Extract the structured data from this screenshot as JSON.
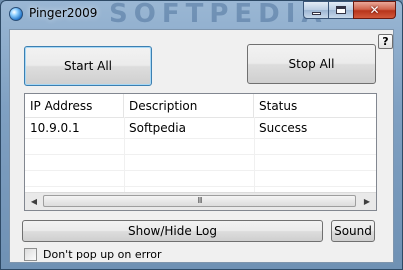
{
  "window": {
    "title": "Pinger2009",
    "watermark": "SOFTPEDIA"
  },
  "caption": {
    "minimize": "minimize",
    "maximize": "maximize",
    "close": "✕"
  },
  "help_label": "?",
  "buttons": {
    "start_all": "Start All",
    "stop_all": "Stop All",
    "show_hide_log": "Show/Hide Log",
    "sound": "Sound"
  },
  "table": {
    "columns": [
      "IP Address",
      "Description",
      "Status"
    ],
    "rows": [
      [
        "10.9.0.1",
        "Softpedia",
        "Success"
      ]
    ]
  },
  "scrollbar": {
    "left_arrow": "◀",
    "right_arrow": "▶",
    "grip": "III"
  },
  "options": {
    "dont_popup_label": "Don't pop up on error",
    "dont_popup_checked": false
  }
}
